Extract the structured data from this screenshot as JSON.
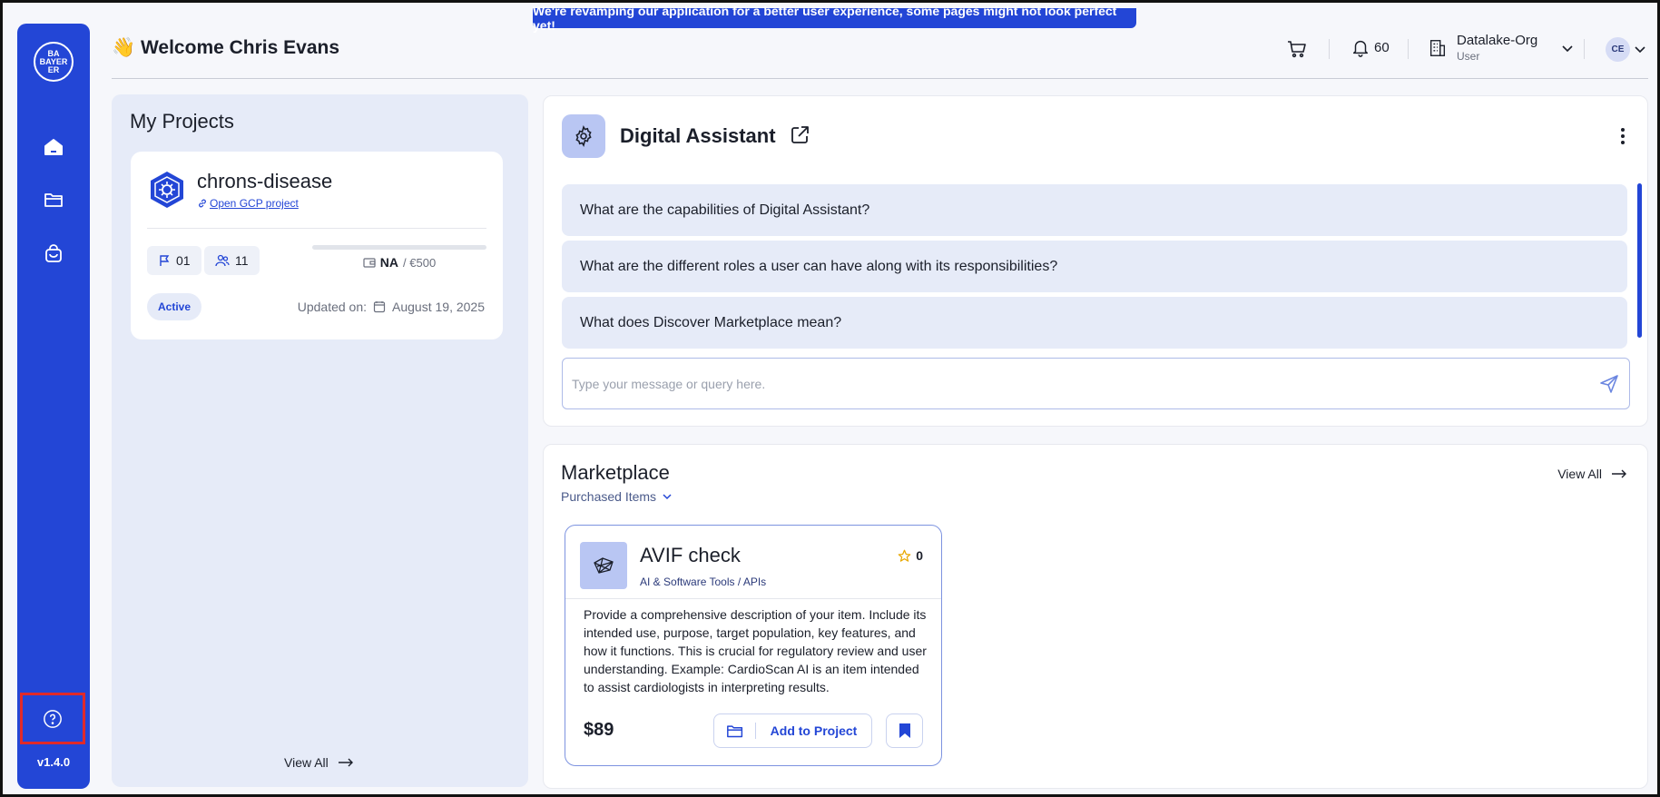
{
  "banner": {
    "text": "We're revamping our application for a better user experience, some pages might not look perfect yet!"
  },
  "sidebar": {
    "logo_text": [
      "BA",
      "BAYER",
      "ER"
    ],
    "version": "v1.4.0"
  },
  "header": {
    "welcome": "👋 Welcome Chris Evans",
    "notifications_count": "60",
    "org_name": "Datalake-Org",
    "org_role": "User",
    "avatar_initials": "CE"
  },
  "projects": {
    "title": "My Projects",
    "card": {
      "name": "chrons-disease",
      "link_label": "Open GCP project",
      "flags": "01",
      "members": "11",
      "budget_used": "NA",
      "budget_total": "/ €500",
      "status": "Active",
      "updated_label": "Updated on:",
      "updated_date": "August 19, 2025"
    },
    "view_all": "View All"
  },
  "assistant": {
    "title": "Digital Assistant",
    "faqs": [
      "What are the capabilities of Digital Assistant?",
      "What are the different roles a user can have along with its responsibilities?",
      "What does Discover Marketplace mean?"
    ],
    "input_placeholder": "Type your message or query here."
  },
  "marketplace": {
    "title": "Marketplace",
    "filter_label": "Purchased Items",
    "view_all": "View All",
    "item": {
      "name": "AVIF check",
      "category": "AI & Software Tools / APIs",
      "rating": "0",
      "description": "Provide a comprehensive description of your item. Include its intended use, purpose, target population, key features, and how it functions. This is crucial for regulatory review and user understanding. Example: CardioScan AI is an item intended to assist cardiologists in interpreting results.",
      "price": "$89",
      "add_label": "Add to Project"
    }
  },
  "colors": {
    "brand": "#2346d6",
    "panel": "#e6ebf8",
    "highlight": "#e02a2a"
  }
}
